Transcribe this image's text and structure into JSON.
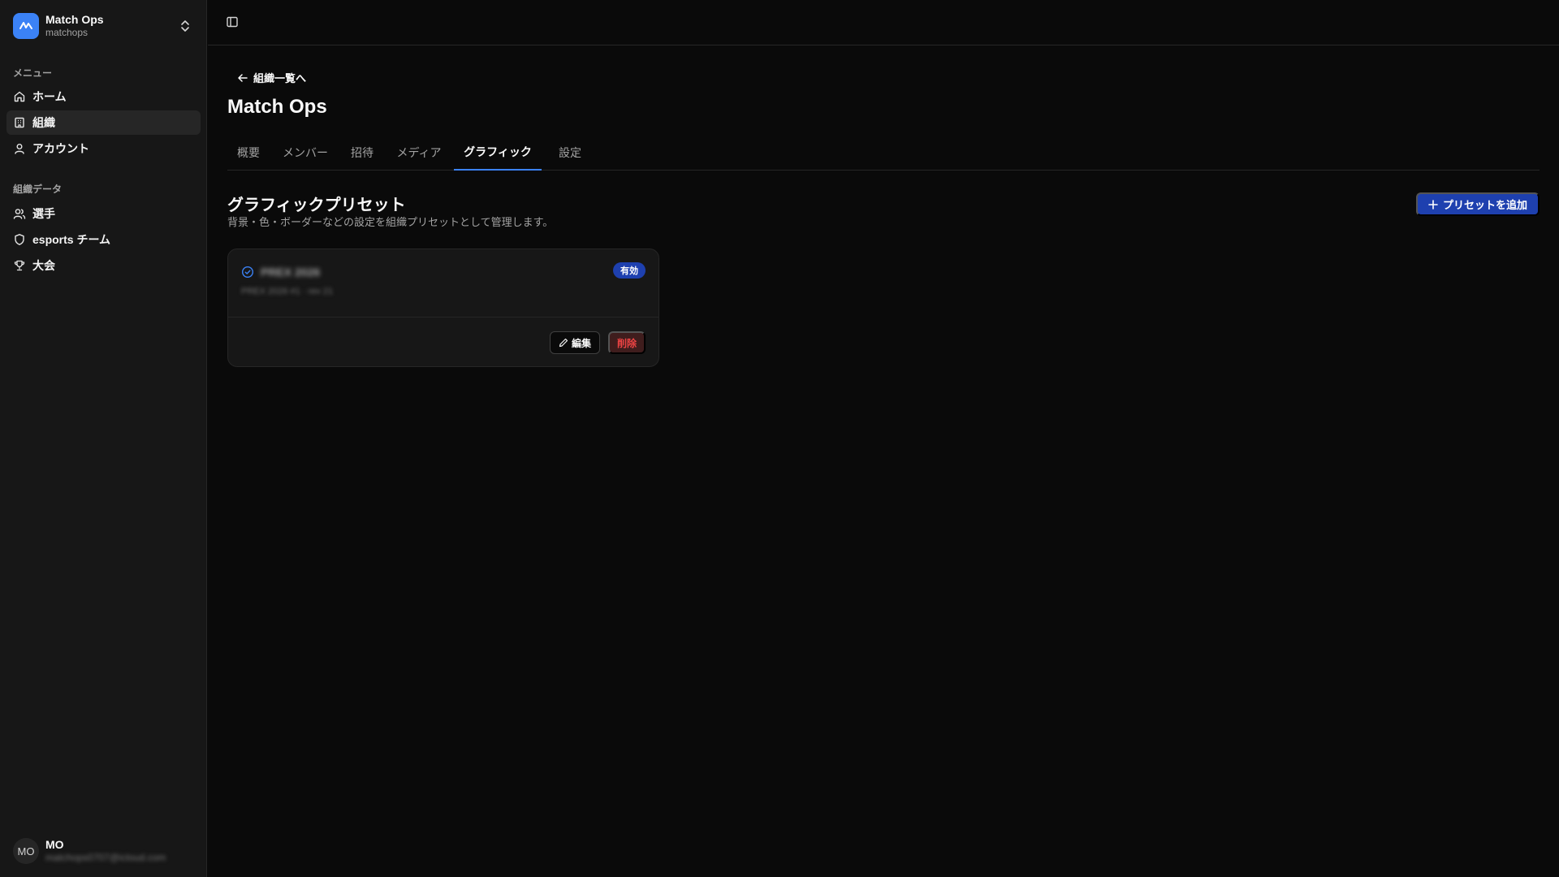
{
  "org": {
    "name": "Match Ops",
    "slug": "matchops"
  },
  "sidebar": {
    "menu_label": "メニュー",
    "menu_items": [
      {
        "label": "ホーム",
        "icon": "home-icon"
      },
      {
        "label": "組織",
        "icon": "building-icon",
        "active": true
      },
      {
        "label": "アカウント",
        "icon": "user-icon"
      }
    ],
    "data_label": "組織データ",
    "data_items": [
      {
        "label": "選手",
        "icon": "users-icon"
      },
      {
        "label": "esports チーム",
        "icon": "shield-icon"
      },
      {
        "label": "大会",
        "icon": "trophy-icon"
      }
    ]
  },
  "user": {
    "initials": "MO",
    "name": "MO",
    "email": "matchops0707@icloud.com"
  },
  "main": {
    "back_label": "組織一覧へ",
    "title": "Match Ops",
    "tabs": [
      {
        "label": "概要"
      },
      {
        "label": "メンバー"
      },
      {
        "label": "招待"
      },
      {
        "label": "メディア"
      },
      {
        "label": "グラフィック",
        "active": true
      },
      {
        "label": "設定"
      }
    ],
    "section": {
      "title": "グラフィックプリセット",
      "description": "背景・色・ボーダーなどの設定を組織プリセットとして管理します。",
      "add_label": "プリセットを追加"
    },
    "preset": {
      "name": "PREX 2026",
      "meta": "PREX 2026 #1 · rev 21",
      "badge": "有効",
      "edit_label": "編集",
      "delete_label": "削除"
    }
  },
  "colors": {
    "accent": "#3b82f6",
    "badge": "#1e40af",
    "danger": "#ef4444",
    "background": "#0a0a0a",
    "sidebar": "#171717"
  }
}
